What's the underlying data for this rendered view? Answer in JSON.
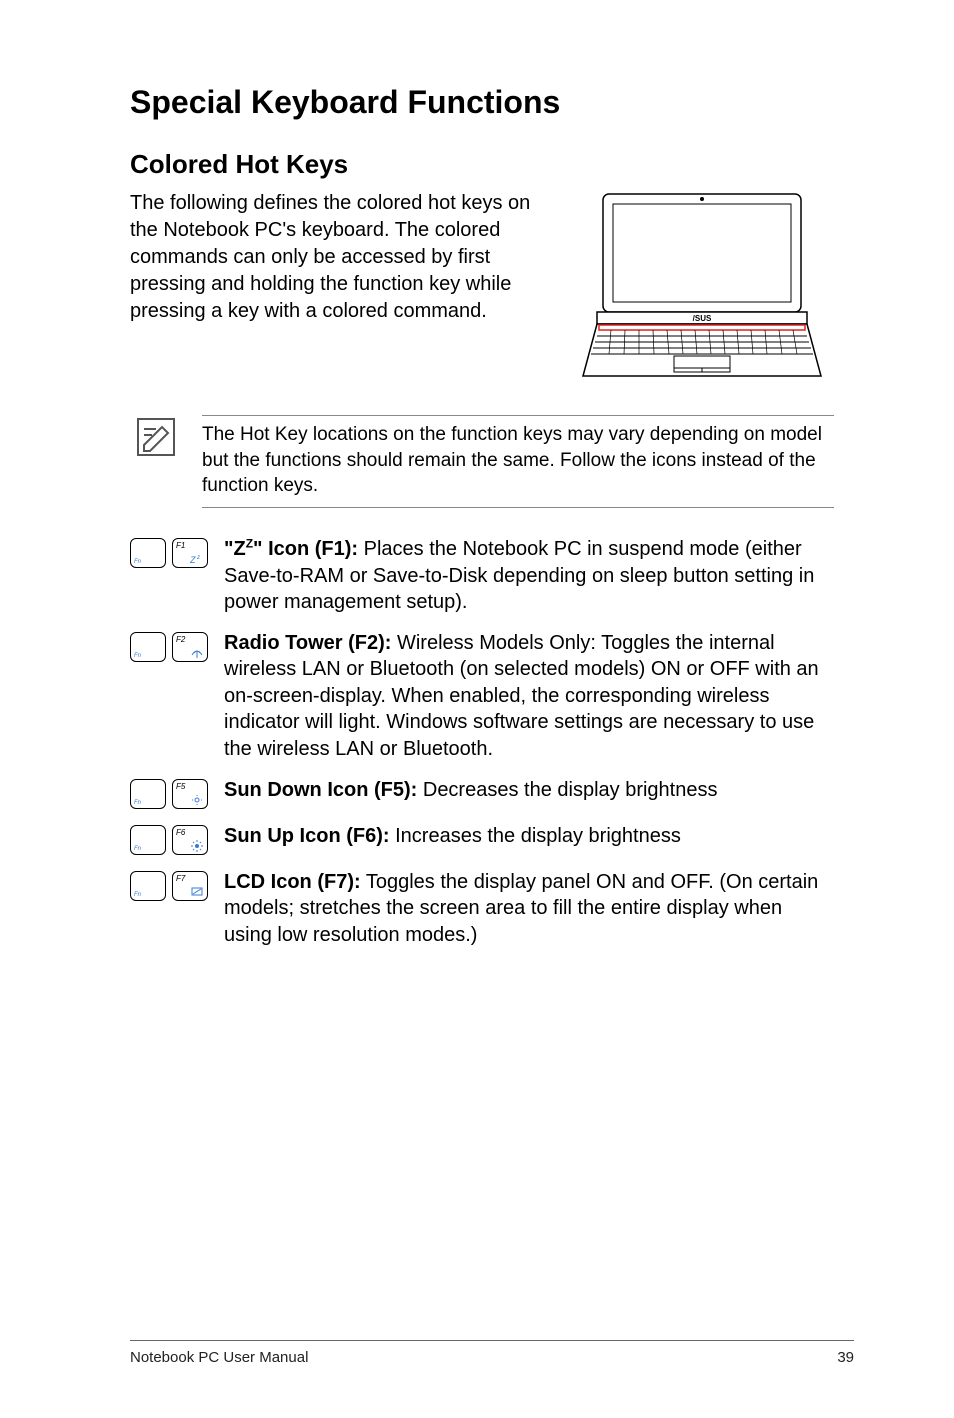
{
  "title": "Special Keyboard Functions",
  "section_heading": "Colored Hot Keys",
  "intro": "The following defines the colored hot keys on the Notebook PC's keyboard. The colored commands can only be accessed by first pressing and holding the function key while pressing a key with a colored command.",
  "note": "The Hot Key locations on the function keys may vary depending on model but the functions should remain the same. Follow the icons instead of the function keys.",
  "hotkeys": [
    {
      "fx": "F1",
      "title_before_sup": "\"Z",
      "sup": "Z",
      "title_after_sup": "\" Icon (F1):",
      "desc": " Places the Notebook PC in suspend mode (either Save-to-RAM or Save-to-Disk depending on sleep button setting in power management setup)."
    },
    {
      "fx": "F2",
      "title": "Radio Tower (F2):",
      "desc": " Wireless Models Only: Toggles the internal wireless LAN or Bluetooth (on selected models) ON or OFF with an on-screen-display. When enabled, the corresponding wireless indicator will light. Windows software settings are necessary to use the wireless LAN or Bluetooth."
    },
    {
      "fx": "F5",
      "title": "Sun Down Icon (F5):",
      "desc": " Decreases the display brightness"
    },
    {
      "fx": "F6",
      "title": "Sun Up Icon (F6):",
      "desc": " Increases the display brightness"
    },
    {
      "fx": "F7",
      "title": "LCD Icon (F7):",
      "desc": " Toggles the display panel ON and OFF. (On certain models; stretches the screen area to fill the entire display when using low resolution modes.)"
    }
  ],
  "footer_left": "Notebook PC User Manual",
  "footer_right": "39"
}
